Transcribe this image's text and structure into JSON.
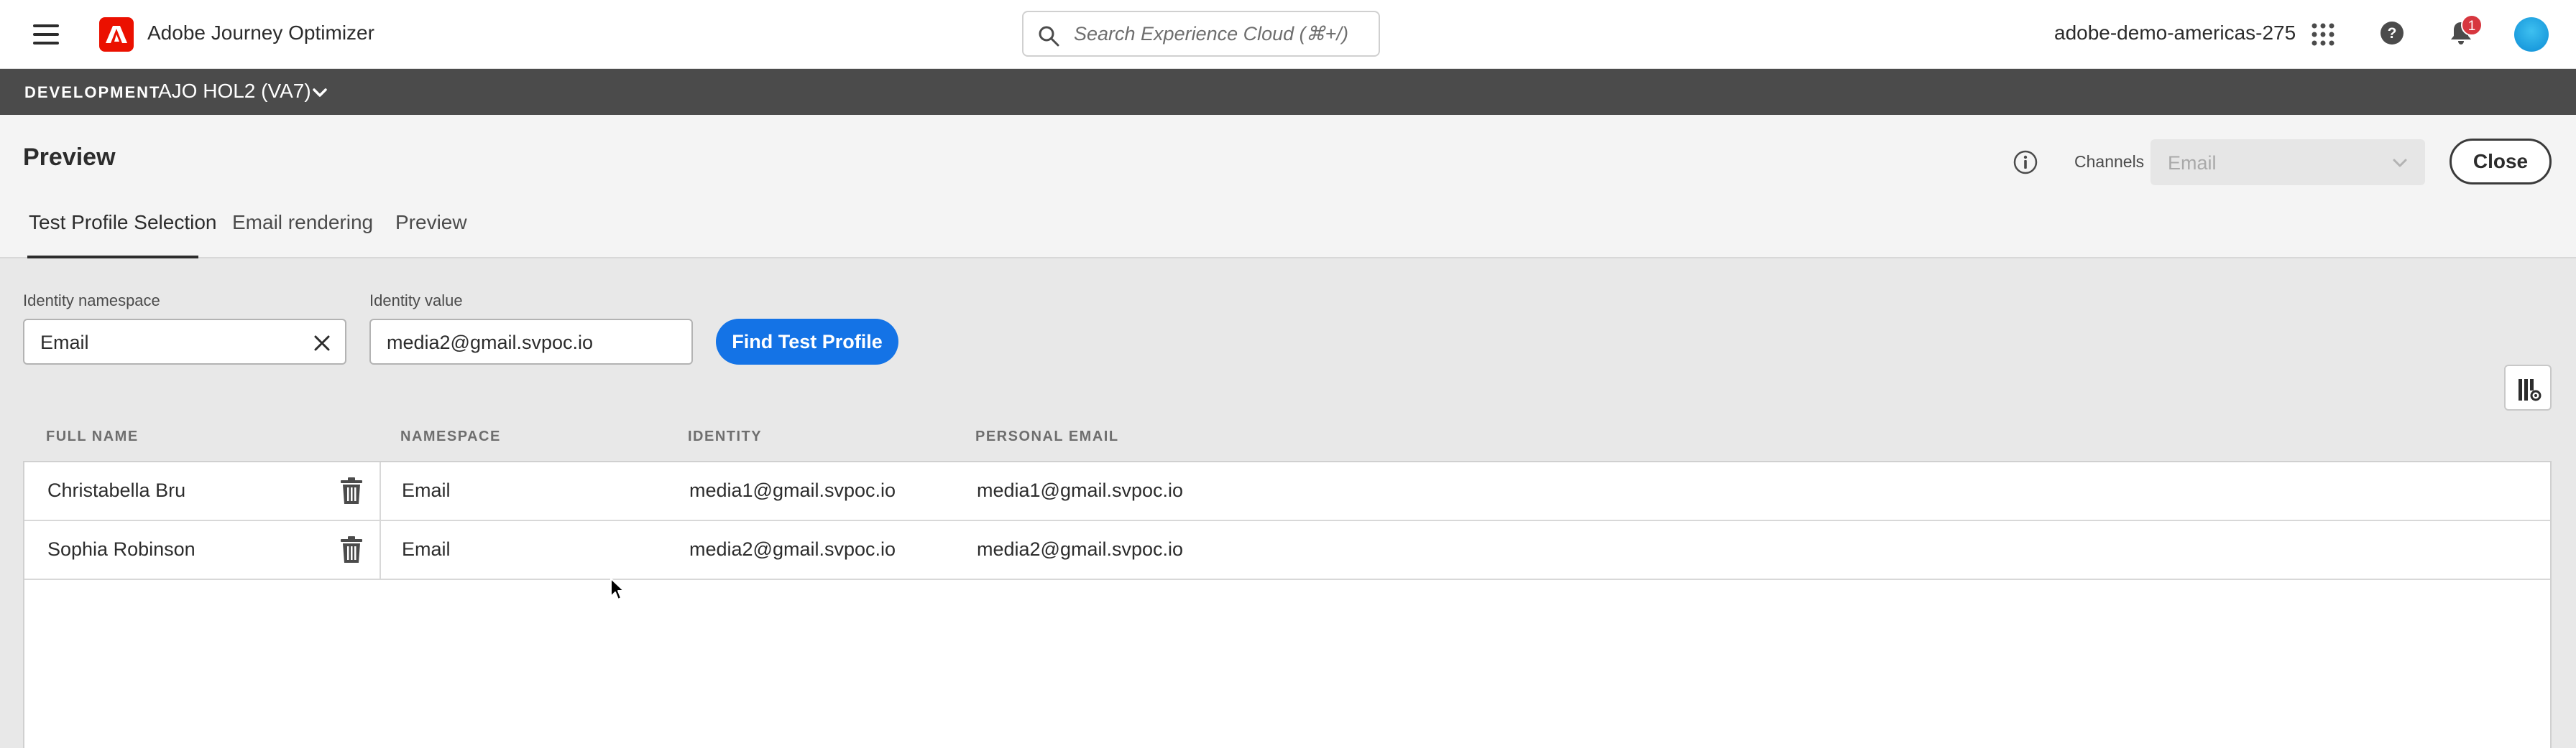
{
  "app": {
    "title": "Adobe Journey Optimizer"
  },
  "search": {
    "placeholder": "Search Experience Cloud (⌘+/)"
  },
  "header_right": {
    "org": "adobe-demo-americas-275",
    "notification_count": "1"
  },
  "sandbox": {
    "environment": "DEVELOPMENT",
    "name": "AJO HOL2 (VA7)"
  },
  "page": {
    "title": "Preview",
    "channels_label": "Channels",
    "channel_value": "Email",
    "close_label": "Close",
    "tabs": [
      {
        "label": "Test Profile Selection",
        "active": true
      },
      {
        "label": "Email rendering",
        "active": false
      },
      {
        "label": "Preview",
        "active": false
      }
    ]
  },
  "form": {
    "namespace_label": "Identity namespace",
    "namespace_value": "Email",
    "identity_label": "Identity value",
    "identity_value": "media2@gmail.svpoc.io",
    "find_button": "Find Test Profile"
  },
  "table": {
    "columns": [
      "FULL NAME",
      "NAMESPACE",
      "IDENTITY",
      "PERSONAL EMAIL"
    ],
    "rows": [
      {
        "full_name": "Christabella Bru",
        "namespace": "Email",
        "identity": "media1@gmail.svpoc.io",
        "personal_email": "media1@gmail.svpoc.io"
      },
      {
        "full_name": "Sophia Robinson",
        "namespace": "Email",
        "identity": "media2@gmail.svpoc.io",
        "personal_email": "media2@gmail.svpoc.io"
      }
    ]
  },
  "colors": {
    "accent": "#1473e6",
    "brand": "#eb1000",
    "sandbox_bar": "#4b4b4b",
    "badge": "#d7373f"
  }
}
